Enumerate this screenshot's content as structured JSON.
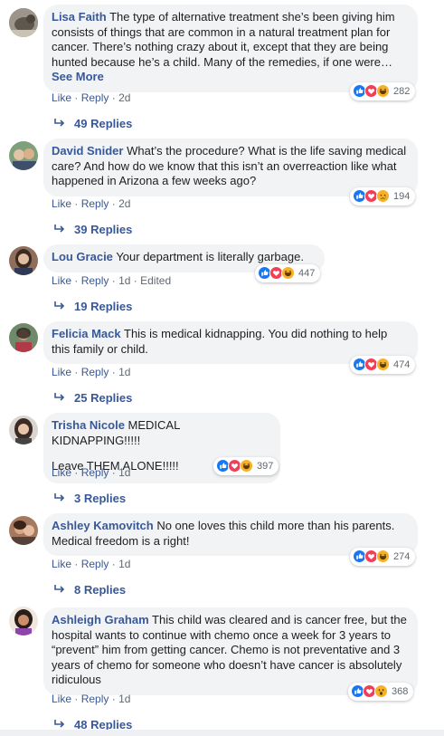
{
  "comments": [
    {
      "author": "Lisa Faith",
      "text": "The type of alternative treatment she’s been giving him consists of things that are common in a natural treatment plan for cancer. There’s nothing crazy about it, except that they are being hunted because he’s a child. Many of the remedies, if one were…",
      "see_more": "See More",
      "like": "Like",
      "reply": "Reply",
      "time": "2d",
      "edited": "",
      "reaction_count": "282",
      "reactions": [
        "like-icon",
        "love-icon",
        "haha-icon"
      ],
      "replies_label": "49 Replies"
    },
    {
      "author": "David Snider",
      "text": "What’s the procedure? What is the life saving medical care? And how do we know that this isn’t an overreaction like what happened in Arizona a few weeks ago?",
      "like": "Like",
      "reply": "Reply",
      "time": "2d",
      "edited": "",
      "reaction_count": "194",
      "reactions": [
        "like-icon",
        "love-icon",
        "sad-icon"
      ],
      "replies_label": "39 Replies"
    },
    {
      "author": "Lou Gracie",
      "text": "Your department is literally garbage.",
      "like": "Like",
      "reply": "Reply",
      "time": "1d",
      "edited": "Edited",
      "reaction_count": "447",
      "reactions": [
        "like-icon",
        "love-icon",
        "haha-icon"
      ],
      "replies_label": "19 Replies"
    },
    {
      "author": "Felicia Mack",
      "text": "This is medical kidnapping. You did nothing to help this family or child.",
      "like": "Like",
      "reply": "Reply",
      "time": "1d",
      "edited": "",
      "reaction_count": "474",
      "reactions": [
        "like-icon",
        "love-icon",
        "haha-icon"
      ],
      "replies_label": "25 Replies"
    },
    {
      "author": "Trisha Nicole",
      "text": "MEDICAL KIDNAPPING!!!!!",
      "text2": "Leave THEM ALONE!!!!!",
      "like": "Like",
      "reply": "Reply",
      "time": "1d",
      "edited": "",
      "reaction_count": "397",
      "reactions": [
        "like-icon",
        "love-icon",
        "haha-icon"
      ],
      "replies_label": "3 Replies"
    },
    {
      "author": "Ashley Kamovitch",
      "text": "No one loves this child more than his parents. Medical freedom is a right!",
      "like": "Like",
      "reply": "Reply",
      "time": "1d",
      "edited": "",
      "reaction_count": "274",
      "reactions": [
        "like-icon",
        "love-icon",
        "haha-icon"
      ],
      "replies_label": "8 Replies"
    },
    {
      "author": "Ashleigh Graham",
      "text": "This child was cleared and is cancer free, but the hospital wants to continue with chemo once a week for 3 years to “prevent” him from getting cancer. Chemo is not preventative and 3 years of chemo for someone who doesn’t have cancer is absolutely ridiculous",
      "like": "Like",
      "reply": "Reply",
      "time": "1d",
      "edited": "",
      "reaction_count": "368",
      "reactions": [
        "like-icon",
        "love-icon",
        "wow-icon"
      ],
      "replies_label": "48 Replies"
    }
  ],
  "colors": {
    "link": "#385898",
    "bubble": "#f2f3f5",
    "meta": "#606770",
    "like_blue": "#1877f2",
    "love_red": "#f33e58",
    "haha_yellow": "#f7b125"
  }
}
